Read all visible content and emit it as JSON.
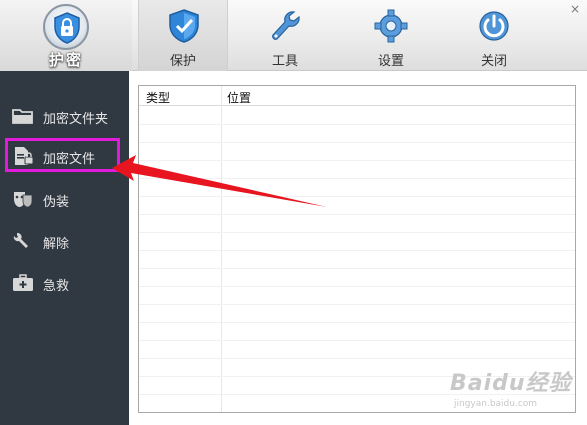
{
  "app": {
    "logo_text": "护密",
    "close_glyph": "×"
  },
  "nav": {
    "tabs": [
      {
        "label": "保护",
        "icon": "shield-icon",
        "active": true
      },
      {
        "label": "工具",
        "icon": "wrench-icon",
        "active": false
      },
      {
        "label": "设置",
        "icon": "gear-icon",
        "active": false
      },
      {
        "label": "关闭",
        "icon": "power-icon",
        "active": false
      }
    ]
  },
  "sidebar": {
    "items": [
      {
        "label": "加密文件夹",
        "icon": "folder-icon"
      },
      {
        "label": "加密文件",
        "icon": "file-lock-icon",
        "highlighted": true
      },
      {
        "label": "伪装",
        "icon": "mask-icon"
      },
      {
        "label": "解除",
        "icon": "unlock-icon"
      },
      {
        "label": "急救",
        "icon": "first-aid-kit-icon"
      }
    ]
  },
  "table": {
    "columns": [
      "类型",
      "位置"
    ],
    "rows": []
  },
  "watermark": {
    "brand": "Baidu经验",
    "url": "jingyan.baidu.com"
  },
  "colors": {
    "sidebar_bg": "#303842",
    "highlight": "#e21ad9",
    "arrow": "#e8141f",
    "accent_blue": "#2a7ed3"
  }
}
